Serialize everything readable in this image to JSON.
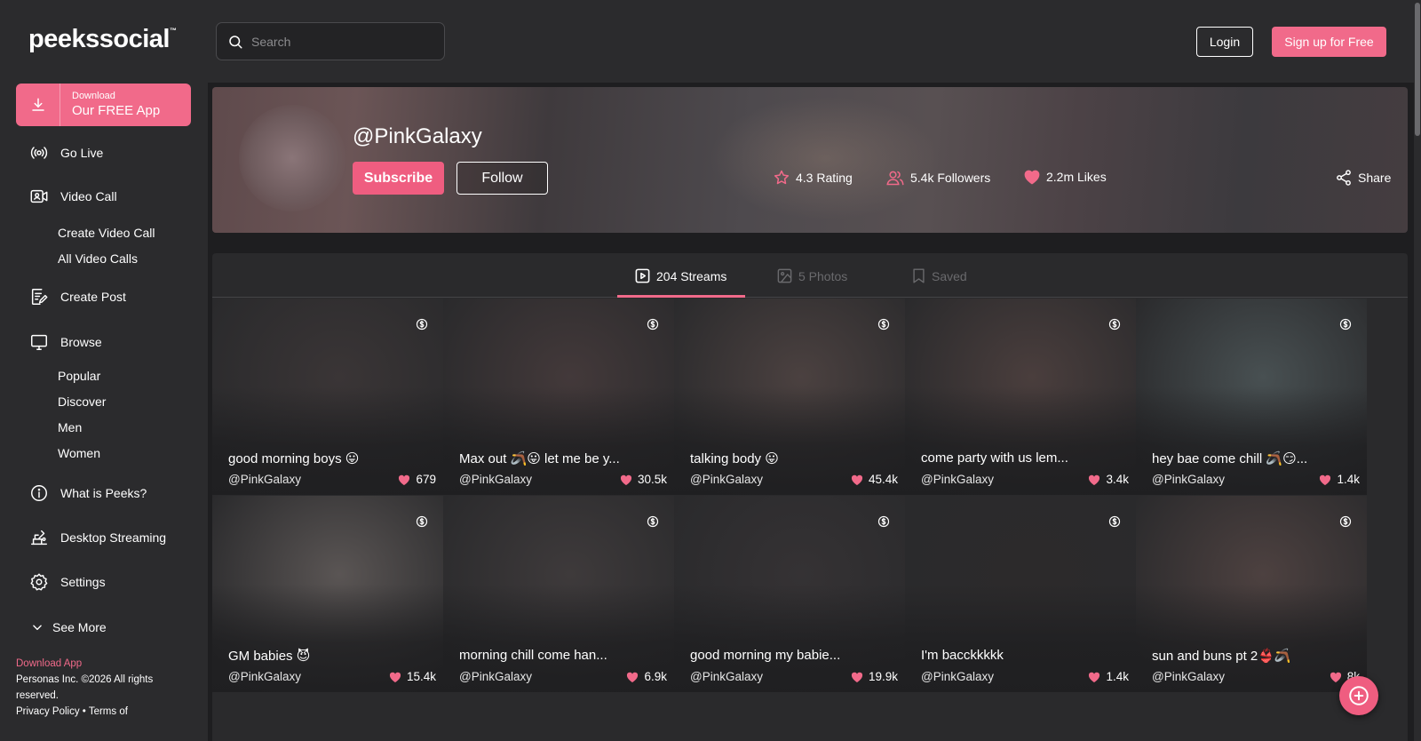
{
  "brand": {
    "logo_text": "peekssocial",
    "logo_mark": "™",
    "accent": "#f16a8a"
  },
  "header": {
    "search_placeholder": "Search",
    "login_label": "Login",
    "signup_label": "Sign up for Free"
  },
  "sidebar": {
    "download": {
      "small": "Download",
      "big": "Our FREE App"
    },
    "go_live": "Go Live",
    "video_call": "Video Call",
    "create_video_call": "Create Video Call",
    "all_video_calls": "All Video Calls",
    "create_post": "Create Post",
    "browse": "Browse",
    "browse_items": [
      "Popular",
      "Discover",
      "Men",
      "Women"
    ],
    "what_is": "What is Peeks?",
    "desktop_streaming": "Desktop Streaming",
    "settings": "Settings",
    "see_more": "See More",
    "footer": {
      "download_app": "Download App",
      "copyright": "Personas Inc. ©2026 All rights reserved.",
      "privacy": "Privacy Policy",
      "bullet": "•",
      "terms": "Terms of"
    }
  },
  "profile": {
    "handle": "@PinkGalaxy",
    "subscribe_label": "Subscribe",
    "follow_label": "Follow",
    "rating": "4.3 Rating",
    "followers": "5.4k Followers",
    "likes": "2.2m Likes",
    "share_label": "Share"
  },
  "tabs": {
    "streams": "204 Streams",
    "photos": "5 Photos",
    "saved": "Saved"
  },
  "streams": [
    {
      "title": "good morning boys 😛",
      "user": "@PinkGalaxy",
      "likes": "679",
      "bg": "#3a3536"
    },
    {
      "title": "Max out 🪃😛 let me be y...",
      "user": "@PinkGalaxy",
      "likes": "30.5k",
      "bg": "#43393a"
    },
    {
      "title": "talking body 😛",
      "user": "@PinkGalaxy",
      "likes": "45.4k",
      "bg": "#4b4140"
    },
    {
      "title": "come party with us lem...",
      "user": "@PinkGalaxy",
      "likes": "3.4k",
      "bg": "#4a3e3d"
    },
    {
      "title": "hey bae come chill 🪃😏...",
      "user": "@PinkGalaxy",
      "likes": "1.4k",
      "bg": "#485052"
    },
    {
      "title": "GM babies 😈",
      "user": "@PinkGalaxy",
      "likes": "15.4k",
      "bg": "#5a5554"
    },
    {
      "title": "morning chill come han...",
      "user": "@PinkGalaxy",
      "likes": "6.9k",
      "bg": "#3e3a3b"
    },
    {
      "title": "good morning my babie...",
      "user": "@PinkGalaxy",
      "likes": "19.9k",
      "bg": "#353234"
    },
    {
      "title": "I'm bacckkkkk",
      "user": "@PinkGalaxy",
      "likes": "1.4k",
      "bg": "#2c2a2b"
    },
    {
      "title": "sun and buns pt 2👙🪃",
      "user": "@PinkGalaxy",
      "likes": "8k",
      "bg": "#4d4140"
    }
  ]
}
